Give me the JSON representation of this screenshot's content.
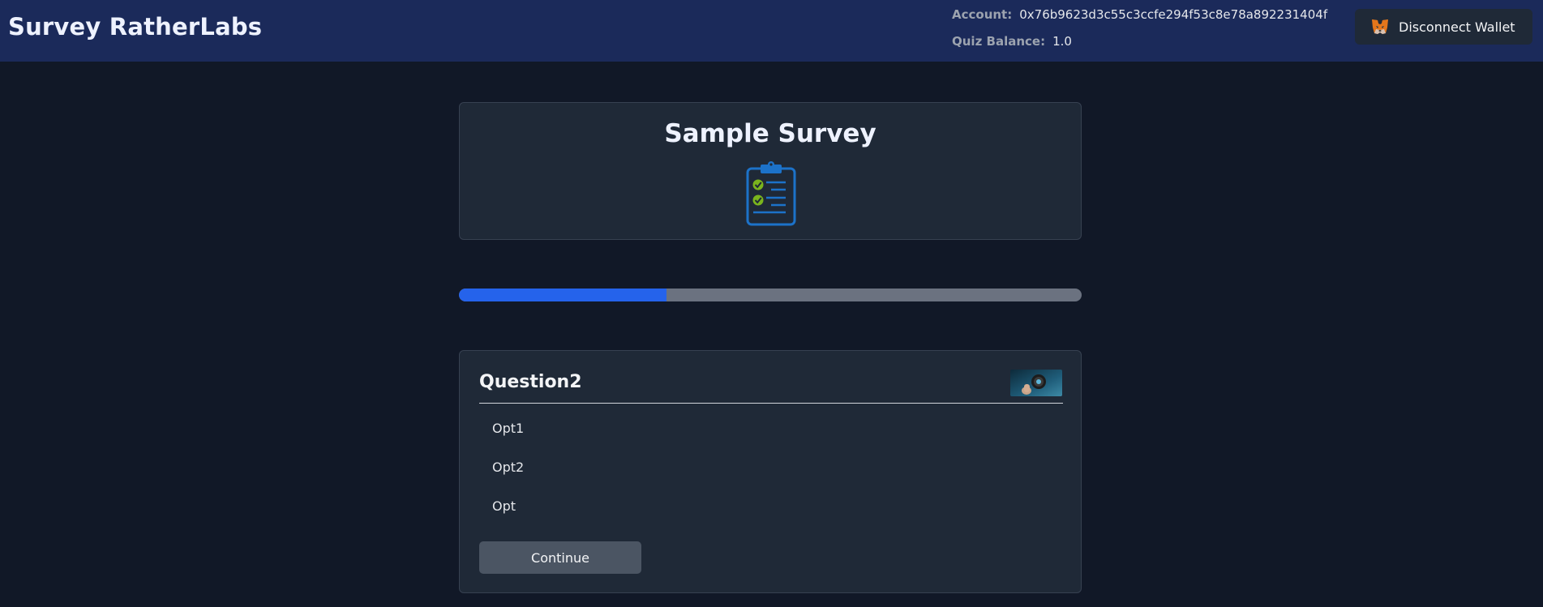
{
  "header": {
    "brand": "Survey RatherLabs",
    "account_label": "Account:",
    "account_value": "0x76b9623d3c55c3ccfe294f53c8e78a892231404f",
    "balance_label": "Quiz Balance:",
    "balance_value": "1.0",
    "wallet_button_label": "Disconnect Wallet",
    "wallet_icon": "metamask-fox-icon"
  },
  "survey": {
    "title": "Sample Survey",
    "icon": "clipboard-checklist-icon"
  },
  "progress": {
    "fraction": 0.333,
    "fill_color": "#2563eb",
    "track_color": "#6b7280"
  },
  "question": {
    "title": "Question2",
    "options": [
      "Opt1",
      "Opt2",
      "Opt"
    ],
    "continue_label": "Continue"
  },
  "colors": {
    "background": "#111827",
    "topbar": "#1b2a5a",
    "card": "#1f2937",
    "accent": "#2563eb"
  }
}
